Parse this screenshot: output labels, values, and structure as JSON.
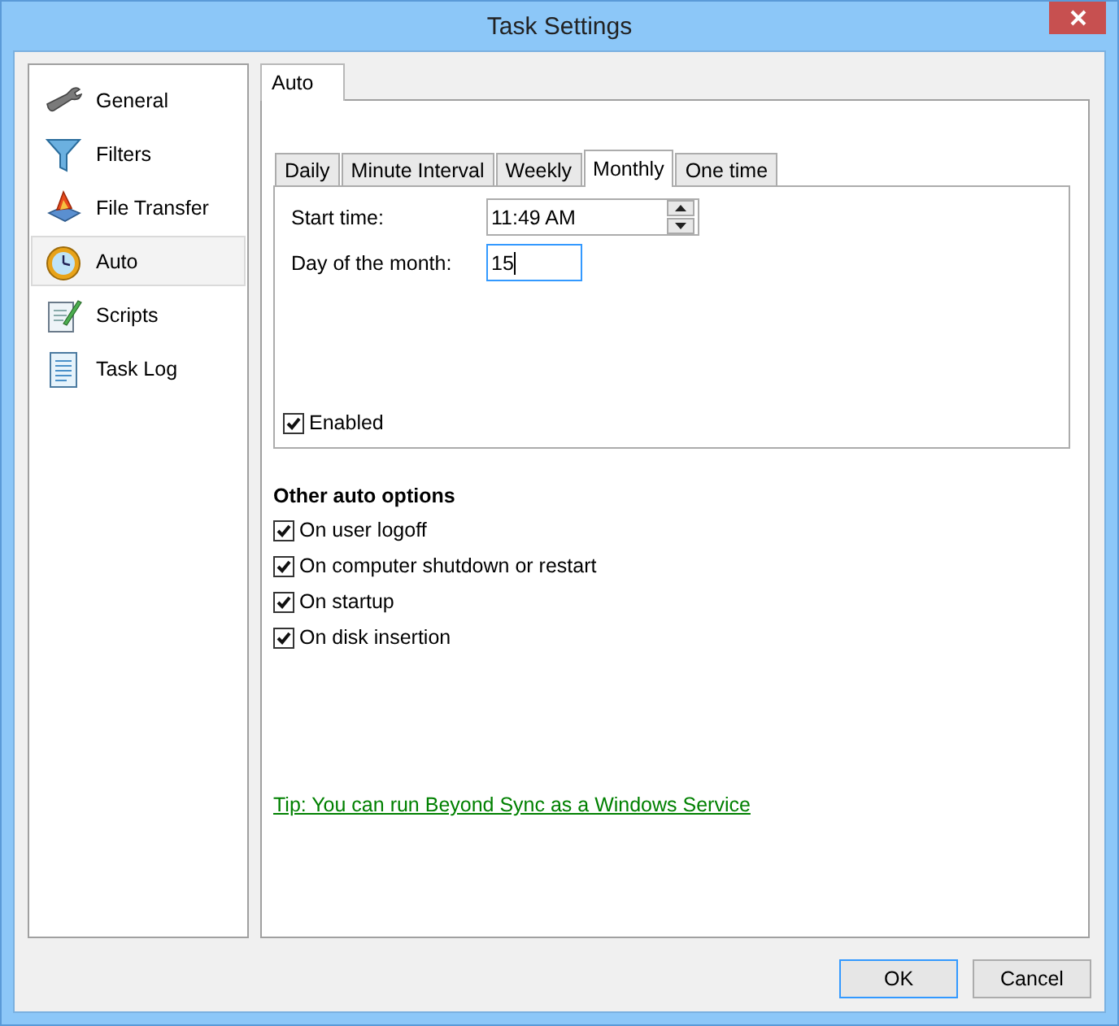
{
  "window": {
    "title": "Task Settings"
  },
  "sidebar": {
    "items": [
      {
        "label": "General",
        "selected": false
      },
      {
        "label": "Filters",
        "selected": false
      },
      {
        "label": "File Transfer",
        "selected": false
      },
      {
        "label": "Auto",
        "selected": true
      },
      {
        "label": "Scripts",
        "selected": false
      },
      {
        "label": "Task Log",
        "selected": false
      }
    ]
  },
  "tabs": [
    {
      "label": "Auto",
      "selected": true
    }
  ],
  "schedule_tabs": [
    {
      "label": "Daily",
      "selected": false
    },
    {
      "label": "Minute Interval",
      "selected": false
    },
    {
      "label": "Weekly",
      "selected": false
    },
    {
      "label": "Monthly",
      "selected": true
    },
    {
      "label": "One time",
      "selected": false
    }
  ],
  "start_time": {
    "label": "Start time:",
    "value": "11:49 AM"
  },
  "day_of_month": {
    "label": "Day of the month:",
    "value": "15",
    "focused": true
  },
  "enabled": {
    "label": "Enabled",
    "checked": true
  },
  "other_options": {
    "title": "Other auto options",
    "items": [
      {
        "label": "On user logoff",
        "checked": true
      },
      {
        "label": "On computer shutdown or restart",
        "checked": true
      },
      {
        "label": "On startup",
        "checked": true
      },
      {
        "label": "On disk insertion",
        "checked": true
      }
    ]
  },
  "tip_link": "Tip: You can run Beyond Sync as a Windows Service",
  "buttons": [
    {
      "label": "OK",
      "default": true
    },
    {
      "label": "Cancel",
      "default": false
    }
  ]
}
